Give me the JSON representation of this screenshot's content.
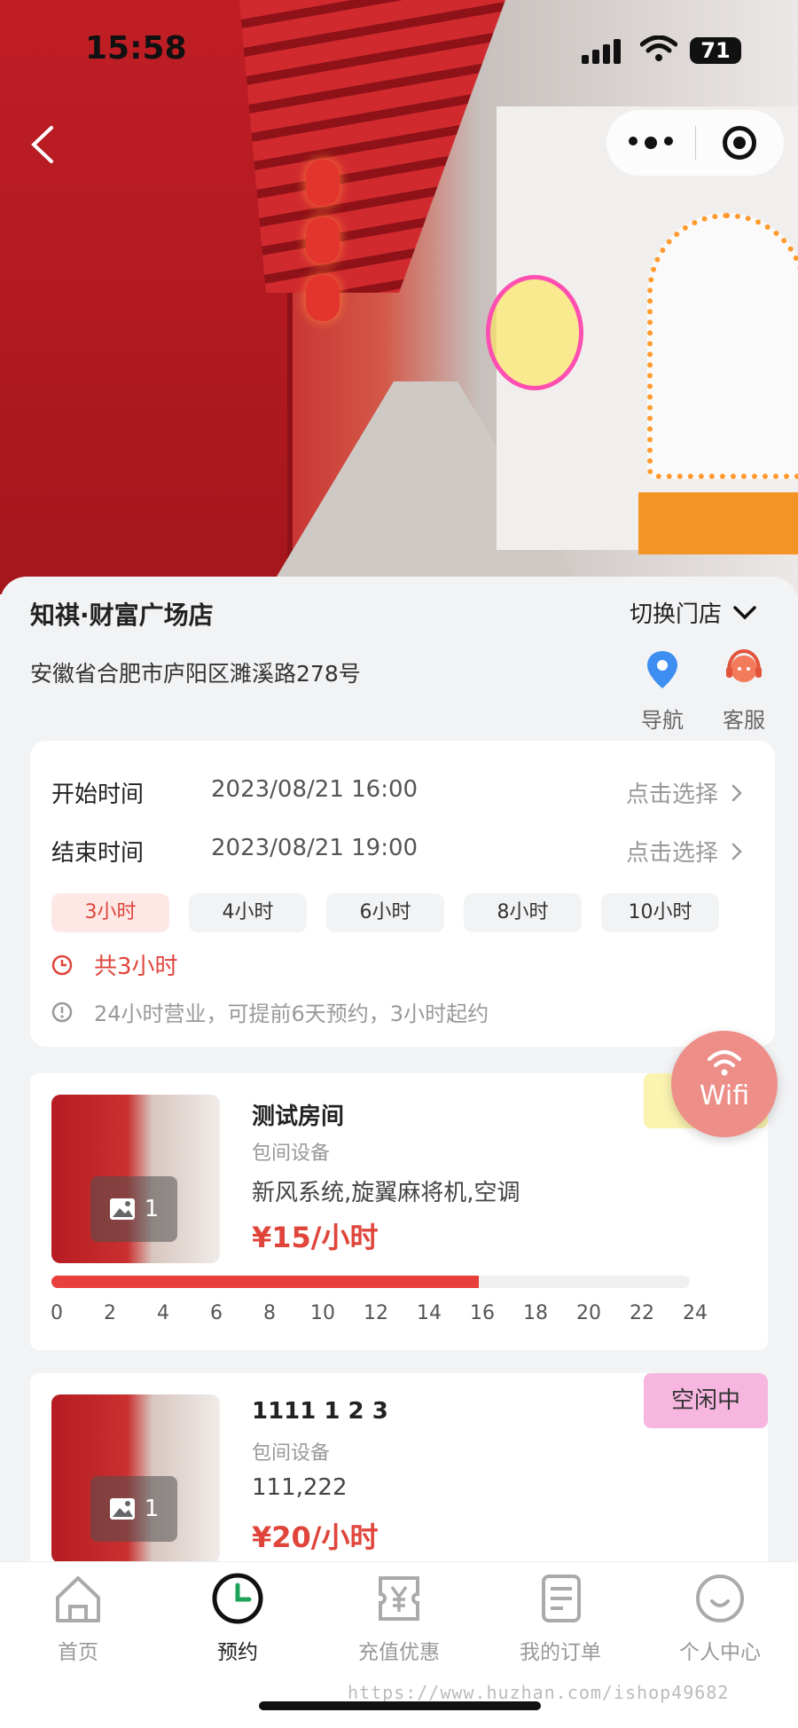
{
  "status_bar": {
    "time": "15:58",
    "battery": "71"
  },
  "store": {
    "name": "知祺·财富广场店",
    "switch_label": "切换门店",
    "address": "安徽省合肥市庐阳区濉溪路278号",
    "nav_label": "导航",
    "service_label": "客服"
  },
  "booking": {
    "start_label": "开始时间",
    "start_value": "2023/08/21 16:00",
    "end_label": "结束时间",
    "end_value": "2023/08/21 19:00",
    "pick_label": "点击选择",
    "durations": [
      "3小时",
      "4小时",
      "6小时",
      "8小时",
      "10小时"
    ],
    "selected_duration": "3小时",
    "total": "共3小时",
    "info": "24小时营业，可提前6天预约，3小时起约"
  },
  "wifi_button": {
    "label": "Wifi"
  },
  "rooms": [
    {
      "name": "测试房间",
      "subtitle": "包间设备",
      "features": "新风系统,旋翼麻将机,空调",
      "price": "¥15/小时",
      "image_count": "1",
      "badge": "",
      "usage_fraction": 0.67,
      "ticks": [
        "0",
        "2",
        "4",
        "6",
        "8",
        "10",
        "12",
        "14",
        "16",
        "18",
        "20",
        "22",
        "24"
      ]
    },
    {
      "name": "1111 1 2 3",
      "subtitle": "包间设备",
      "features": "111,222",
      "price": "¥20/小时",
      "image_count": "1",
      "badge": "空闲中"
    }
  ],
  "tabbar": [
    {
      "label": "首页",
      "icon": "home-icon",
      "active": false
    },
    {
      "label": "预约",
      "icon": "clock-icon",
      "active": true
    },
    {
      "label": "充值优惠",
      "icon": "yen-ticket-icon",
      "active": false
    },
    {
      "label": "我的订单",
      "icon": "order-icon",
      "active": false
    },
    {
      "label": "个人中心",
      "icon": "profile-icon",
      "active": false
    }
  ],
  "watermark": "https://www.huzhan.com/ishop49682",
  "colors": {
    "accent": "#e0453b",
    "free_badge": "#f6b6df",
    "busy_badge": "#fbf3b0",
    "fab": "#ed8e88"
  }
}
